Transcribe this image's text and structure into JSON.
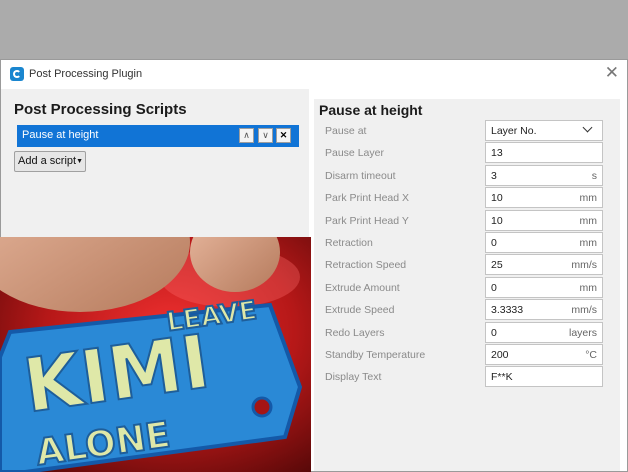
{
  "window": {
    "title": "Post Processing Plugin"
  },
  "left": {
    "heading": "Post Processing Scripts",
    "scripts": [
      {
        "label": "Pause at height"
      }
    ],
    "add_label": "Add a script"
  },
  "right": {
    "heading": "Pause at height",
    "settings": [
      {
        "label": "Pause at",
        "value": "Layer No.",
        "unit": ""
      },
      {
        "label": "Pause Layer",
        "value": "13",
        "unit": ""
      },
      {
        "label": "Disarm timeout",
        "value": "3",
        "unit": "s"
      },
      {
        "label": "Park Print Head X",
        "value": "10",
        "unit": "mm"
      },
      {
        "label": "Park Print Head Y",
        "value": "10",
        "unit": "mm"
      },
      {
        "label": "Retraction",
        "value": "0",
        "unit": "mm"
      },
      {
        "label": "Retraction Speed",
        "value": "25",
        "unit": "mm/s"
      },
      {
        "label": "Extrude Amount",
        "value": "0",
        "unit": "mm"
      },
      {
        "label": "Extrude Speed",
        "value": "3.3333",
        "unit": "mm/s"
      },
      {
        "label": "Redo Layers",
        "value": "0",
        "unit": "layers"
      },
      {
        "label": "Standby Temperature",
        "value": "200",
        "unit": "°C"
      },
      {
        "label": "Display Text",
        "value": "F**K",
        "unit": ""
      }
    ]
  },
  "photo": {
    "keychain_lines": [
      "LEAVE",
      "KIMI",
      "ALONE"
    ]
  }
}
